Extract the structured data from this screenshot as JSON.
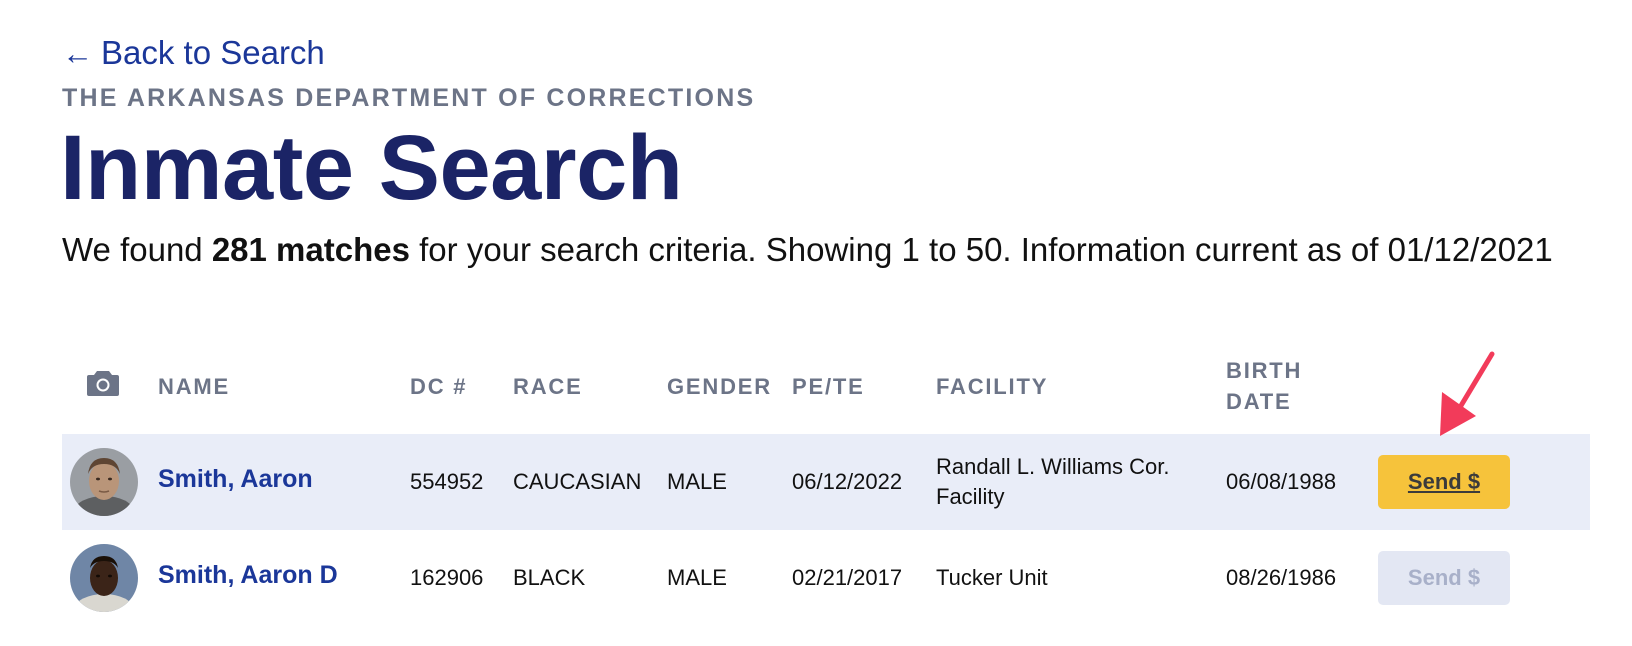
{
  "nav": {
    "back_label": "Back to Search",
    "back_arrow": "←"
  },
  "header": {
    "org": "THE ARKANSAS DEPARTMENT OF CORRECTIONS",
    "title": "Inmate Search"
  },
  "summary": {
    "prefix": "We found ",
    "matches": "281 matches",
    "suffix": " for your search criteria. Showing 1 to 50. Information current as of 01/12/2021"
  },
  "table": {
    "columns": {
      "photo_icon": "camera-icon",
      "name": "NAME",
      "dc": "DC #",
      "race": "RACE",
      "gender": "GENDER",
      "pete": "PE/TE",
      "facility": "FACILITY",
      "birth_line1": "BIRTH",
      "birth_line2": "DATE"
    },
    "rows": [
      {
        "name": "Smith, Aaron",
        "dc": "554952",
        "race": "CAUCASIAN",
        "gender": "MALE",
        "pete": "06/12/2022",
        "facility_line1": "Randall L. Williams Cor.",
        "facility_line2": "Facility",
        "birth": "06/08/1988",
        "send_label": "Send $",
        "highlighted": true
      },
      {
        "name": "Smith, Aaron D",
        "dc": "162906",
        "race": "BLACK",
        "gender": "MALE",
        "pete": "02/21/2017",
        "facility_line1": "Tucker Unit",
        "facility_line2": "",
        "birth": "08/26/1986",
        "send_label": "Send $",
        "highlighted": false
      }
    ]
  },
  "colors": {
    "title": "#1b2466",
    "link": "#1b3799",
    "muted": "#6c7487",
    "row_highlight": "#e9edf8",
    "send_active": "#f6c33b",
    "send_disabled": "#e3e7f3",
    "annotation_arrow": "#f23b5a"
  }
}
